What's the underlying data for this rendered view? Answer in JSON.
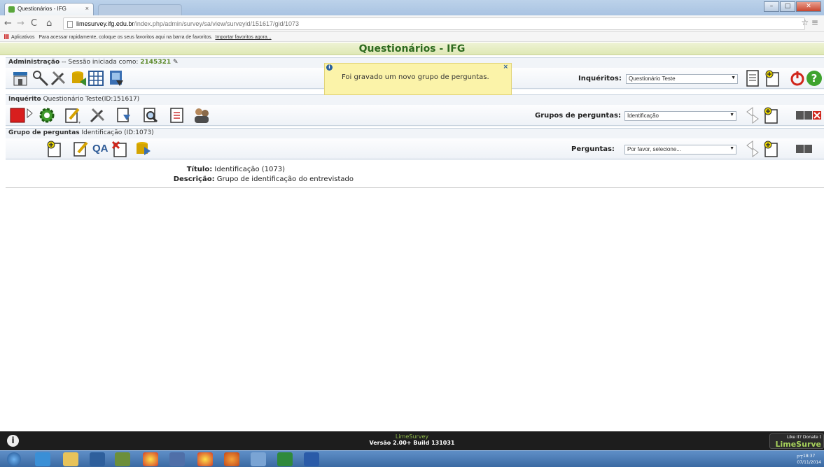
{
  "browser": {
    "tab_title": "Questionários - IFG",
    "tab_close": "×",
    "url_host": "limesurvey.ifg.edu.br",
    "url_path": "/index.php/admin/survey/sa/view/surveyid/151617/gid/1073",
    "bookmarks_apps": "Aplicativos",
    "bookmarks_hint": "Para acessar rapidamente, coloque os seus favoritos aqui na barra de favoritos.",
    "bookmarks_import": "Importar favoritos agora..."
  },
  "app": {
    "title": "Questionários - IFG"
  },
  "admin_bar": {
    "label": "Administração",
    "session_prefix": "-- Sessão iniciada como:",
    "user_id": "2145321",
    "surveys_label": "Inquéritos:",
    "surveys_selected": "Questionário Teste"
  },
  "survey_bar": {
    "label": "Inquérito",
    "detail": "Questionário Teste(ID:151617)",
    "groups_label": "Grupos de perguntas:",
    "groups_selected": "Identificação"
  },
  "group_bar": {
    "label": "Grupo de perguntas",
    "detail": "Identificação (ID:1073)",
    "questions_label": "Perguntas:",
    "questions_selected": "Por favor, selecione...",
    "qa_text": "QA"
  },
  "notification": {
    "message": "Foi gravado um novo grupo de perguntas.",
    "close": "×"
  },
  "group_details": {
    "title_label": "Título:",
    "title_value": "Identificação (1073)",
    "description_label": "Descrição:",
    "description_value": "Grupo de identificação do entrevistado"
  },
  "footer": {
    "name": "LimeSurvey",
    "version": "Versão 2.00+ Build 131031",
    "donate_small": "Like it? Donate t",
    "donate_big": "LimeSurve"
  },
  "taskbar": {
    "tray_text": "PT",
    "time": "18:37",
    "date": "07/11/2014"
  },
  "colors": {
    "title_green": "#2e6b1f",
    "notice_yellow": "#fbf3a9",
    "footer_dark": "#1d1d1d"
  }
}
